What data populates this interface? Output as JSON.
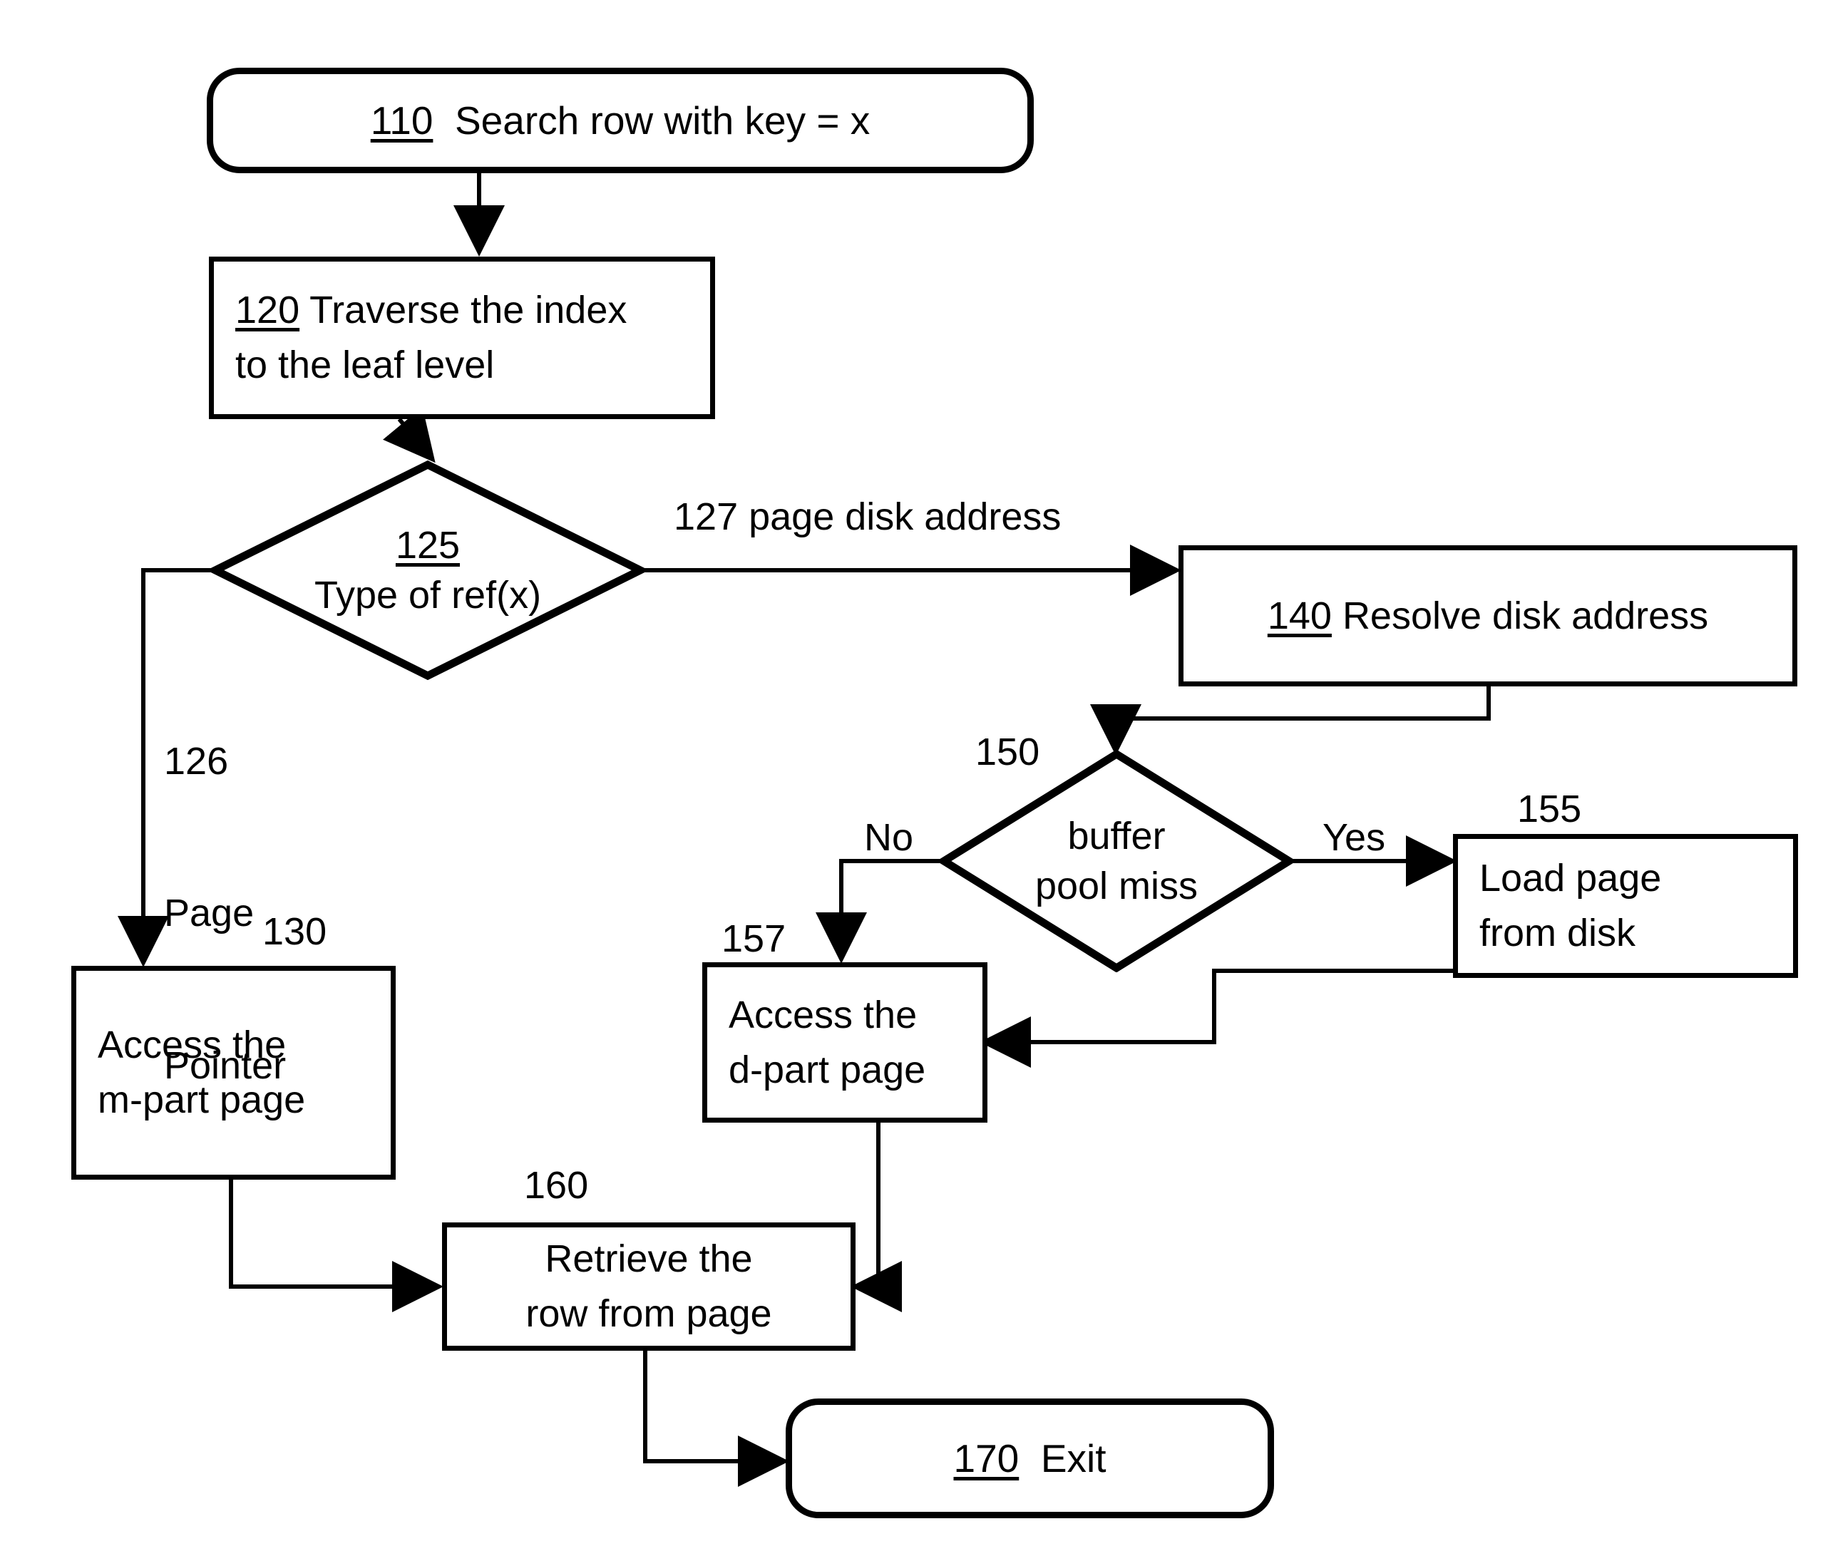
{
  "diagram": {
    "title": "Search row with key = x flowchart",
    "background_color": "#ffffff",
    "stroke_color": "#000000"
  },
  "nodes": {
    "n110": {
      "ref": "110",
      "shape": "terminator",
      "text": "Search row with key = x"
    },
    "n120": {
      "ref": "120",
      "shape": "process",
      "line1": "Traverse the index",
      "line2": "to the leaf level"
    },
    "n125": {
      "ref": "125",
      "shape": "decision",
      "text": "Type of ref(x)"
    },
    "n140": {
      "ref": "140",
      "shape": "process",
      "text": "Resolve disk address"
    },
    "n150": {
      "ref": "150",
      "shape": "decision",
      "line1": "buffer",
      "line2": "pool miss"
    },
    "n155": {
      "ref": "155",
      "shape": "process",
      "line1": "Load page",
      "line2": "from disk"
    },
    "n157": {
      "ref": "157",
      "shape": "process",
      "line1": "Access the",
      "line2": "d-part page"
    },
    "n130": {
      "ref": "130",
      "shape": "process",
      "line1": "Access the",
      "line2": "m-part page"
    },
    "n160": {
      "ref": "160",
      "shape": "process",
      "line1": "Retrieve the",
      "line2": "row from page"
    },
    "n170": {
      "ref": "170",
      "shape": "terminator",
      "text": "Exit"
    }
  },
  "edge_labels": {
    "disk_address": "127 page disk address",
    "page_pointer_ref": "126",
    "page_pointer_l1": "Page",
    "page_pointer_l2": "Pointer",
    "no": "No",
    "yes": "Yes"
  },
  "chart_data": {
    "type": "flowchart",
    "nodes": [
      {
        "id": "110",
        "label": "110  Search row with key = x",
        "shape": "terminator"
      },
      {
        "id": "120",
        "label": "120 Traverse the index to the leaf level",
        "shape": "process"
      },
      {
        "id": "125",
        "label": "125 Type of ref(x)",
        "shape": "decision"
      },
      {
        "id": "126",
        "label": "126 Page Pointer",
        "shape": "edge-label"
      },
      {
        "id": "127",
        "label": "127 page disk address",
        "shape": "edge-label"
      },
      {
        "id": "130",
        "label": "130 Access the m-part page",
        "shape": "process"
      },
      {
        "id": "140",
        "label": "140 Resolve disk address",
        "shape": "process"
      },
      {
        "id": "150",
        "label": "150 buffer pool miss",
        "shape": "decision"
      },
      {
        "id": "155",
        "label": "155 Load page from disk",
        "shape": "process"
      },
      {
        "id": "157",
        "label": "157 Access the d-part page",
        "shape": "process"
      },
      {
        "id": "160",
        "label": "160 Retrieve the row from page",
        "shape": "process"
      },
      {
        "id": "170",
        "label": "170  Exit",
        "shape": "terminator"
      }
    ],
    "edges": [
      {
        "from": "110",
        "to": "120",
        "label": ""
      },
      {
        "from": "120",
        "to": "125",
        "label": ""
      },
      {
        "from": "125",
        "to": "130",
        "label": "126 Page Pointer"
      },
      {
        "from": "125",
        "to": "140",
        "label": "127 page disk address"
      },
      {
        "from": "140",
        "to": "150",
        "label": ""
      },
      {
        "from": "150",
        "to": "157",
        "label": "No"
      },
      {
        "from": "150",
        "to": "155",
        "label": "Yes"
      },
      {
        "from": "155",
        "to": "157",
        "label": ""
      },
      {
        "from": "130",
        "to": "160",
        "label": ""
      },
      {
        "from": "157",
        "to": "160",
        "label": ""
      },
      {
        "from": "160",
        "to": "170",
        "label": ""
      }
    ]
  }
}
